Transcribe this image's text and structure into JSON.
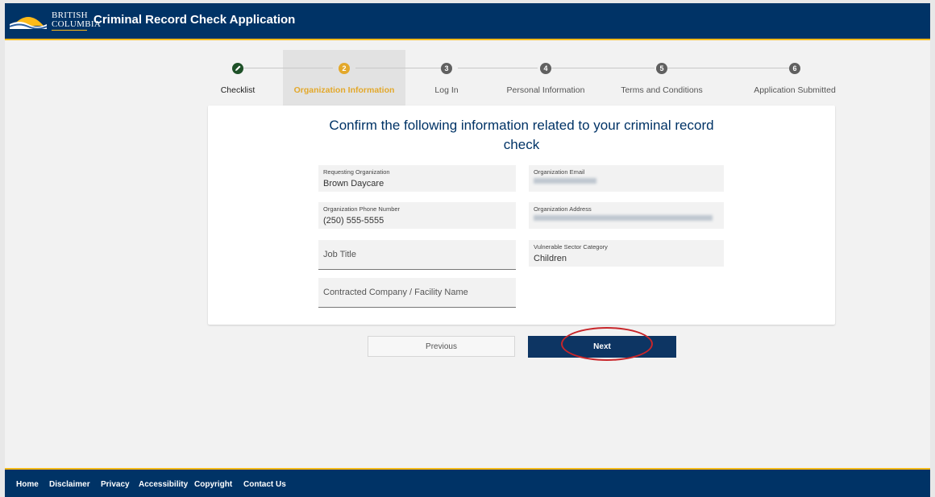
{
  "header": {
    "logo_line1": "BRITISH",
    "logo_line2": "COLUMBIA",
    "title": "Criminal Record Check Application"
  },
  "stepper": {
    "steps": [
      {
        "number": "",
        "label": "Checklist",
        "state": "complete",
        "icon": "pencil-icon"
      },
      {
        "number": "2",
        "label": "Organization Information",
        "state": "active"
      },
      {
        "number": "3",
        "label": "Log In",
        "state": "pending"
      },
      {
        "number": "4",
        "label": "Personal Information",
        "state": "pending"
      },
      {
        "number": "5",
        "label": "Terms and Conditions",
        "state": "pending"
      },
      {
        "number": "6",
        "label": "Application Submitted",
        "state": "pending"
      }
    ],
    "colors": {
      "complete": "#1e5128",
      "active": "#e3a82b",
      "pending": "#606060"
    }
  },
  "card": {
    "title_line1": "Confirm the following information related to your criminal record",
    "title_line2": "check",
    "fields": {
      "requesting_org": {
        "label": "Requesting Organization",
        "value": "Brown Daycare"
      },
      "org_email": {
        "label": "Organization Email",
        "value": ""
      },
      "org_phone": {
        "label": "Organization Phone Number",
        "value": "(250) 555-5555"
      },
      "org_address": {
        "label": "Organization Address",
        "value": ""
      },
      "vulnerable_sector": {
        "label": "Vulnerable Sector Category",
        "value": "Children"
      }
    },
    "inputs": {
      "job_title": {
        "placeholder": "Job Title",
        "value": ""
      },
      "contracted_company": {
        "placeholder": "Contracted Company / Facility Name",
        "value": ""
      }
    }
  },
  "buttons": {
    "previous": "Previous",
    "next": "Next"
  },
  "footer": {
    "links": [
      "Home",
      "Disclaimer",
      "Privacy",
      "Accessibility",
      "Copyright",
      "Contact Us"
    ]
  },
  "colors": {
    "header_bg": "#003366",
    "accent": "#fcba19",
    "primary_button": "#0d3563",
    "annotation_ring": "#c8262a"
  }
}
